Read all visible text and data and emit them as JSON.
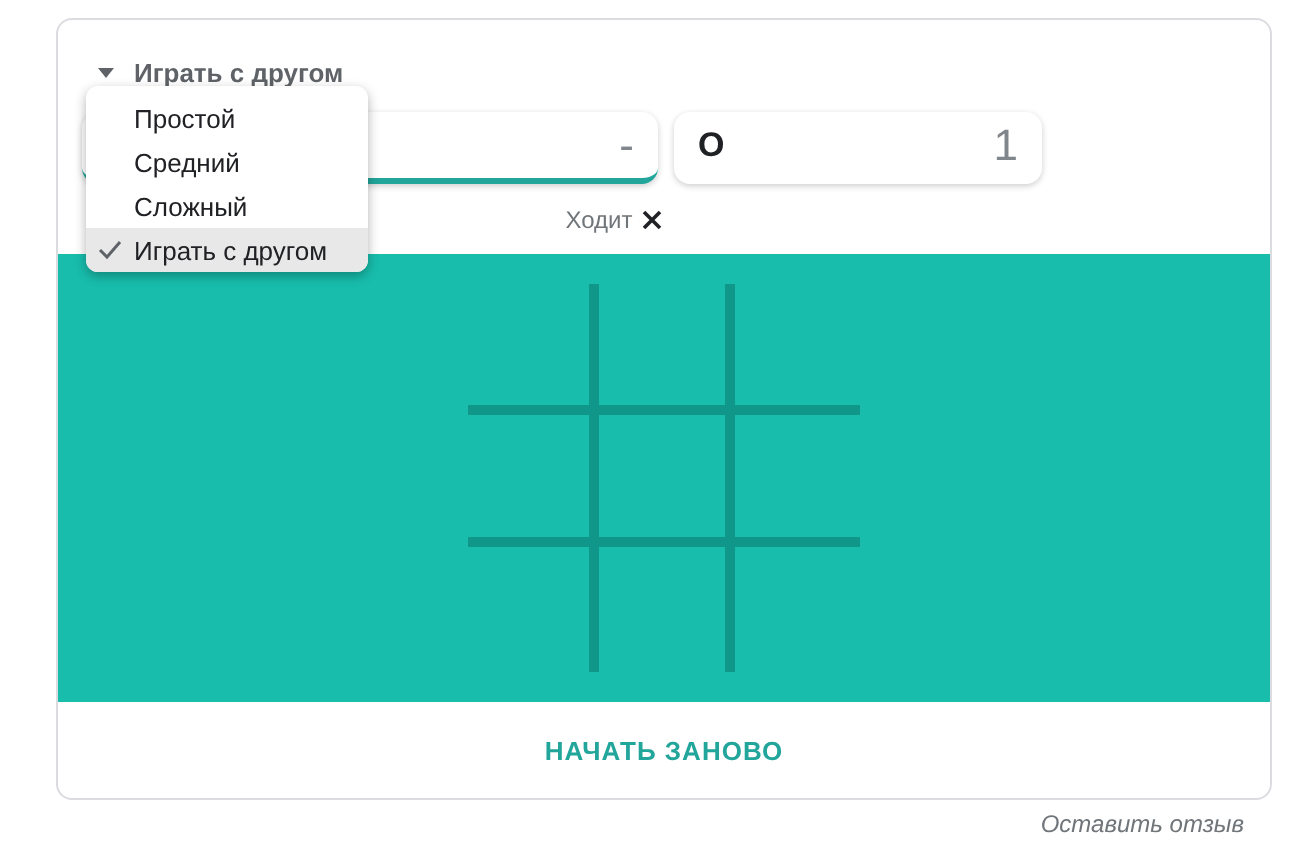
{
  "mode_select": {
    "value": "Играть с другом",
    "expanded": true,
    "options": [
      {
        "label": "Простой",
        "selected": false
      },
      {
        "label": "Средний",
        "selected": false
      },
      {
        "label": "Сложный",
        "selected": false
      },
      {
        "label": "Играть с другом",
        "selected": true
      }
    ]
  },
  "scores": [
    {
      "score": "-",
      "active": true
    },
    {
      "symbol": "O",
      "score": "1",
      "active": false
    }
  ],
  "turn": {
    "label": "Ходит"
  },
  "restart_button": "НАЧАТЬ ЗАНОВО",
  "feedback_link": "Оставить отзыв"
}
